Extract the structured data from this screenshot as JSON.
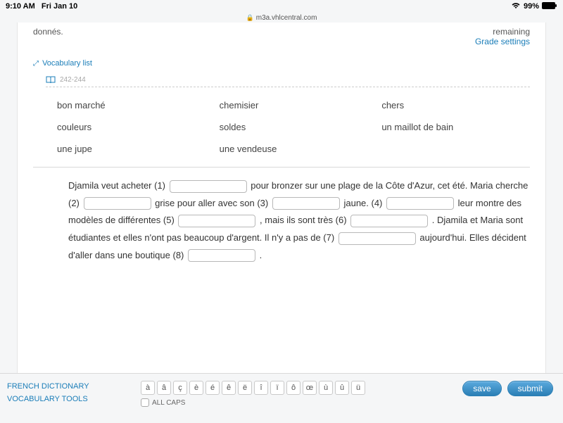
{
  "status": {
    "time": "9:10 AM",
    "date": "Fri Jan 10",
    "battery": "99%"
  },
  "address": {
    "host": "m3a.vhlcentral.com"
  },
  "page": {
    "instruction_tail": "donnés.",
    "remaining_label": "remaining",
    "grade_settings": "Grade settings",
    "vocab_link": "Vocabulary list",
    "page_ref": "242-244"
  },
  "word_bank": [
    "bon marché",
    "chemisier",
    "chers",
    "couleurs",
    "soldes",
    "un maillot de bain",
    "une jupe",
    "une vendeuse",
    ""
  ],
  "exercise": {
    "t1": "Djamila veut acheter (1) ",
    "t2": " pour bronzer sur une plage de la Côte d'Azur, cet été. Maria cherche (2) ",
    "t3": " grise pour aller avec son (3) ",
    "t4": " jaune. (4) ",
    "t5": " leur montre des modèles de différentes (5) ",
    "t6": " , mais ils sont très (6) ",
    "t7": " . Djamila et Maria sont étudiantes et elles n'ont pas beaucoup d'argent. Il n'y a pas de (7) ",
    "t8": " aujourd'hui. Elles décident d'aller dans une boutique (8) ",
    "t9": " ."
  },
  "footer": {
    "dictionary": "FRENCH DICTIONARY",
    "vocab_tools": "VOCABULARY TOOLS",
    "chars": [
      "à",
      "â",
      "ç",
      "è",
      "é",
      "ê",
      "ë",
      "î",
      "ï",
      "ô",
      "œ",
      "ù",
      "û",
      "ü"
    ],
    "all_caps": "ALL CAPS",
    "save": "save",
    "submit": "submit"
  }
}
